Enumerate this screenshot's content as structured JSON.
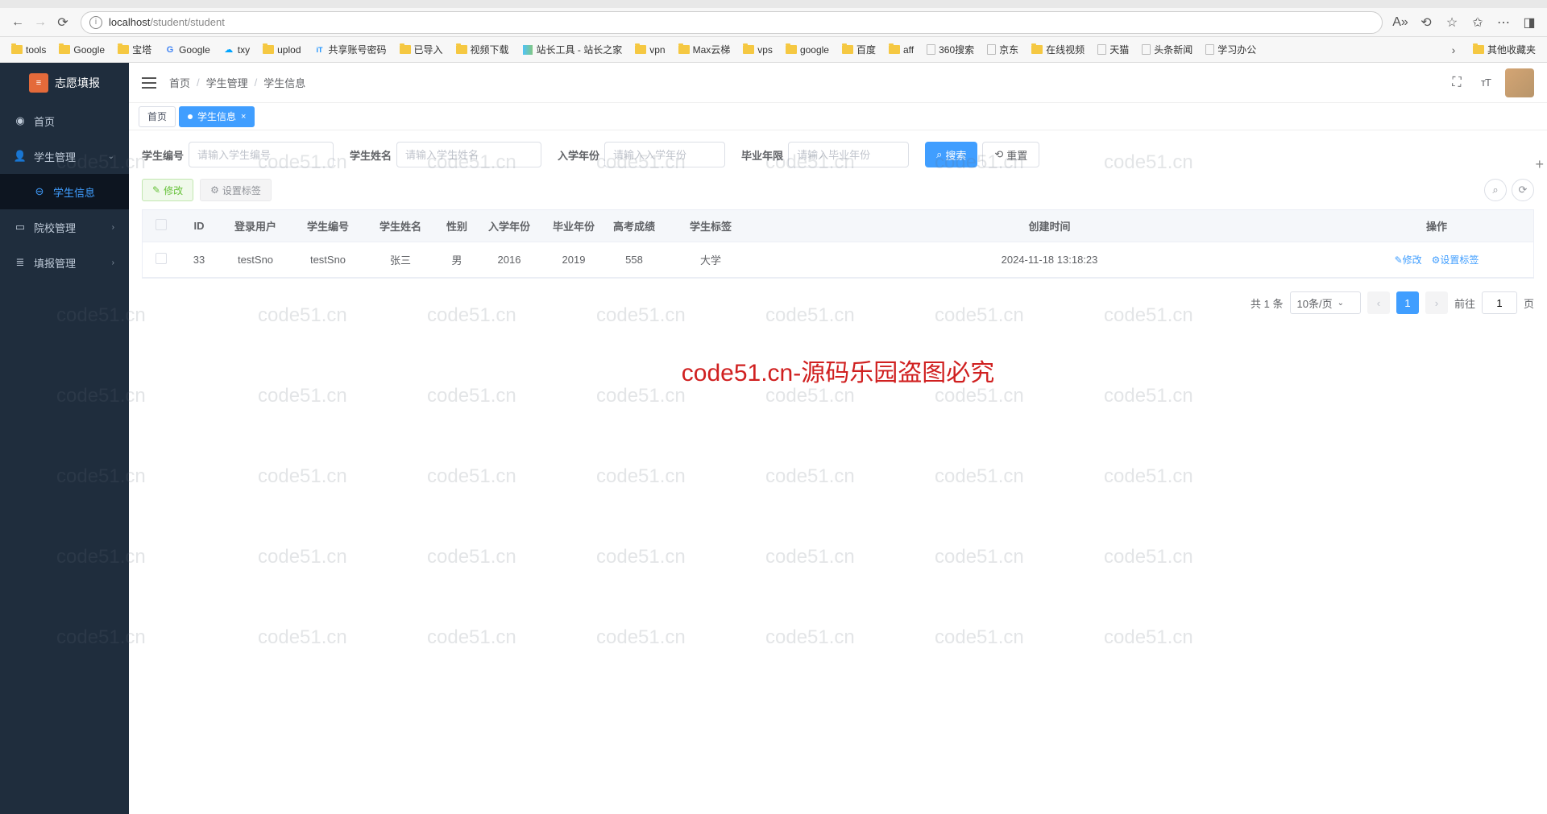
{
  "browser": {
    "url_host": "localhost",
    "url_path": "/student/student",
    "bookmarks": [
      {
        "type": "folder",
        "label": "tools"
      },
      {
        "type": "folder",
        "label": "Google"
      },
      {
        "type": "folder",
        "label": "宝塔"
      },
      {
        "type": "g",
        "label": "Google"
      },
      {
        "type": "cloud",
        "label": "txy"
      },
      {
        "type": "folder",
        "label": "uplod"
      },
      {
        "type": "it",
        "label": "共享账号密码"
      },
      {
        "type": "folder",
        "label": "已导入"
      },
      {
        "type": "folder",
        "label": "视频下载"
      },
      {
        "type": "sz",
        "label": "站长工具 - 站长之家"
      },
      {
        "type": "folder",
        "label": "vpn"
      },
      {
        "type": "folder",
        "label": "Max云梯"
      },
      {
        "type": "folder",
        "label": "vps"
      },
      {
        "type": "folder",
        "label": "google"
      },
      {
        "type": "folder",
        "label": "百度"
      },
      {
        "type": "folder",
        "label": "aff"
      },
      {
        "type": "page",
        "label": "360搜索"
      },
      {
        "type": "page",
        "label": "京东"
      },
      {
        "type": "folder",
        "label": "在线视频"
      },
      {
        "type": "page",
        "label": "天猫"
      },
      {
        "type": "page",
        "label": "头条新闻"
      },
      {
        "type": "page",
        "label": "学习办公"
      }
    ],
    "bookmarks_other": "其他收藏夹"
  },
  "sidebar": {
    "logo_text": "志愿填报",
    "items": [
      {
        "icon": "dashboard",
        "label": "首页",
        "has_children": false
      },
      {
        "icon": "user",
        "label": "学生管理",
        "has_children": true,
        "expanded": true
      },
      {
        "icon": "",
        "label": "学生信息",
        "sub": true,
        "active": true
      },
      {
        "icon": "school",
        "label": "院校管理",
        "has_children": true
      },
      {
        "icon": "form",
        "label": "填报管理",
        "has_children": true
      }
    ]
  },
  "breadcrumb": [
    "首页",
    "学生管理",
    "学生信息"
  ],
  "tabs": [
    {
      "label": "首页",
      "active": false
    },
    {
      "label": "学生信息",
      "active": true,
      "closable": true
    }
  ],
  "filters": {
    "f1_label": "学生编号",
    "f1_ph": "请输入学生编号",
    "f2_label": "学生姓名",
    "f2_ph": "请输入学生姓名",
    "f3_label": "入学年份",
    "f3_ph": "请输入入学年份",
    "f4_label": "毕业年限",
    "f4_ph": "请输入毕业年份",
    "search_btn": "搜索",
    "reset_btn": "重置"
  },
  "toolbar": {
    "edit": "修改",
    "tags": "设置标签"
  },
  "table": {
    "headers": [
      "",
      "ID",
      "登录用户",
      "学生编号",
      "学生姓名",
      "性别",
      "入学年份",
      "毕业年份",
      "高考成绩",
      "学生标签",
      "创建时间",
      "操作"
    ],
    "rows": [
      {
        "id": "33",
        "login": "testSno",
        "sno": "testSno",
        "name": "张三",
        "sex": "男",
        "enroll": "2016",
        "grad": "2019",
        "score": "558",
        "tag": "大学",
        "create": "2024-11-18 13:18:23"
      }
    ],
    "op_edit": "修改",
    "op_tags": "设置标签"
  },
  "pagination": {
    "total": "共 1 条",
    "page_size": "10条/页",
    "current": "1",
    "goto_pre": "前往",
    "goto_suf": "页",
    "goto_val": "1"
  },
  "watermark": "code51.cn-源码乐园盗图必究"
}
